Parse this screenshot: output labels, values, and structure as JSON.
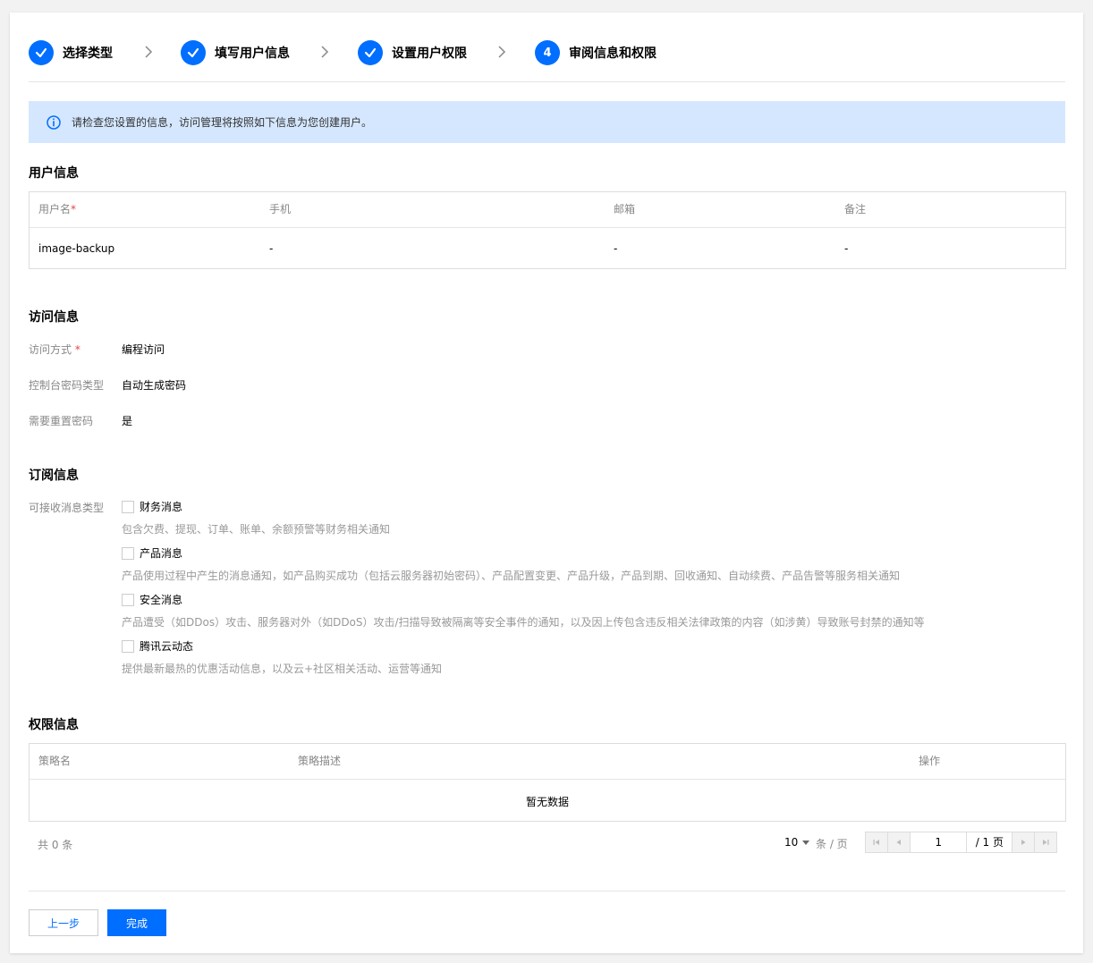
{
  "steps": [
    {
      "label": "选择类型",
      "state": "done"
    },
    {
      "label": "填写用户信息",
      "state": "done"
    },
    {
      "label": "设置用户权限",
      "state": "done"
    },
    {
      "label": "审阅信息和权限",
      "state": "current",
      "number": "4"
    }
  ],
  "alert": {
    "text": "请检查您设置的信息，访问管理将按照如下信息为您创建用户。"
  },
  "user_info": {
    "title": "用户信息",
    "columns": [
      "用户名",
      "手机",
      "邮箱",
      "备注"
    ],
    "required_mark": "*",
    "row": [
      "image-backup",
      "-",
      "-",
      "-"
    ]
  },
  "access_info": {
    "title": "访问信息",
    "fields": [
      {
        "label": "访问方式",
        "value": "编程访问",
        "required": true
      },
      {
        "label": "控制台密码类型",
        "value": "自动生成密码"
      },
      {
        "label": "需要重置密码",
        "value": "是"
      }
    ]
  },
  "subscription": {
    "title": "订阅信息",
    "label": "可接收消息类型",
    "items": [
      {
        "label": "财务消息",
        "desc": "包含欠费、提现、订单、账单、余额预警等财务相关通知",
        "checked": false
      },
      {
        "label": "产品消息",
        "desc": "产品使用过程中产生的消息通知，如产品购买成功（包括云服务器初始密码）、产品配置变更、产品升级，产品到期、回收通知、自动续费、产品告警等服务相关通知",
        "checked": false
      },
      {
        "label": "安全消息",
        "desc": "产品遭受（如DDos）攻击、服务器对外（如DDoS）攻击/扫描导致被隔离等安全事件的通知，以及因上传包含违反相关法律政策的内容（如涉黄）导致账号封禁的通知等",
        "checked": false
      },
      {
        "label": "腾讯云动态",
        "desc": "提供最新最热的优惠活动信息，以及云+社区相关活动、运营等通知",
        "checked": false
      }
    ]
  },
  "permissions": {
    "title": "权限信息",
    "columns": [
      "策略名",
      "策略描述",
      "操作"
    ],
    "empty_text": "暂无数据",
    "total_text": "共 0 条"
  },
  "pager": {
    "page_size": "10",
    "per_page_label": "条 / 页",
    "current_page": "1",
    "total_pages_label": "/ 1 页"
  },
  "buttons": {
    "prev": "上一步",
    "finish": "完成"
  },
  "colors": {
    "primary": "#006eff",
    "alert_bg": "#d5e7ff",
    "required": "#e54545"
  }
}
